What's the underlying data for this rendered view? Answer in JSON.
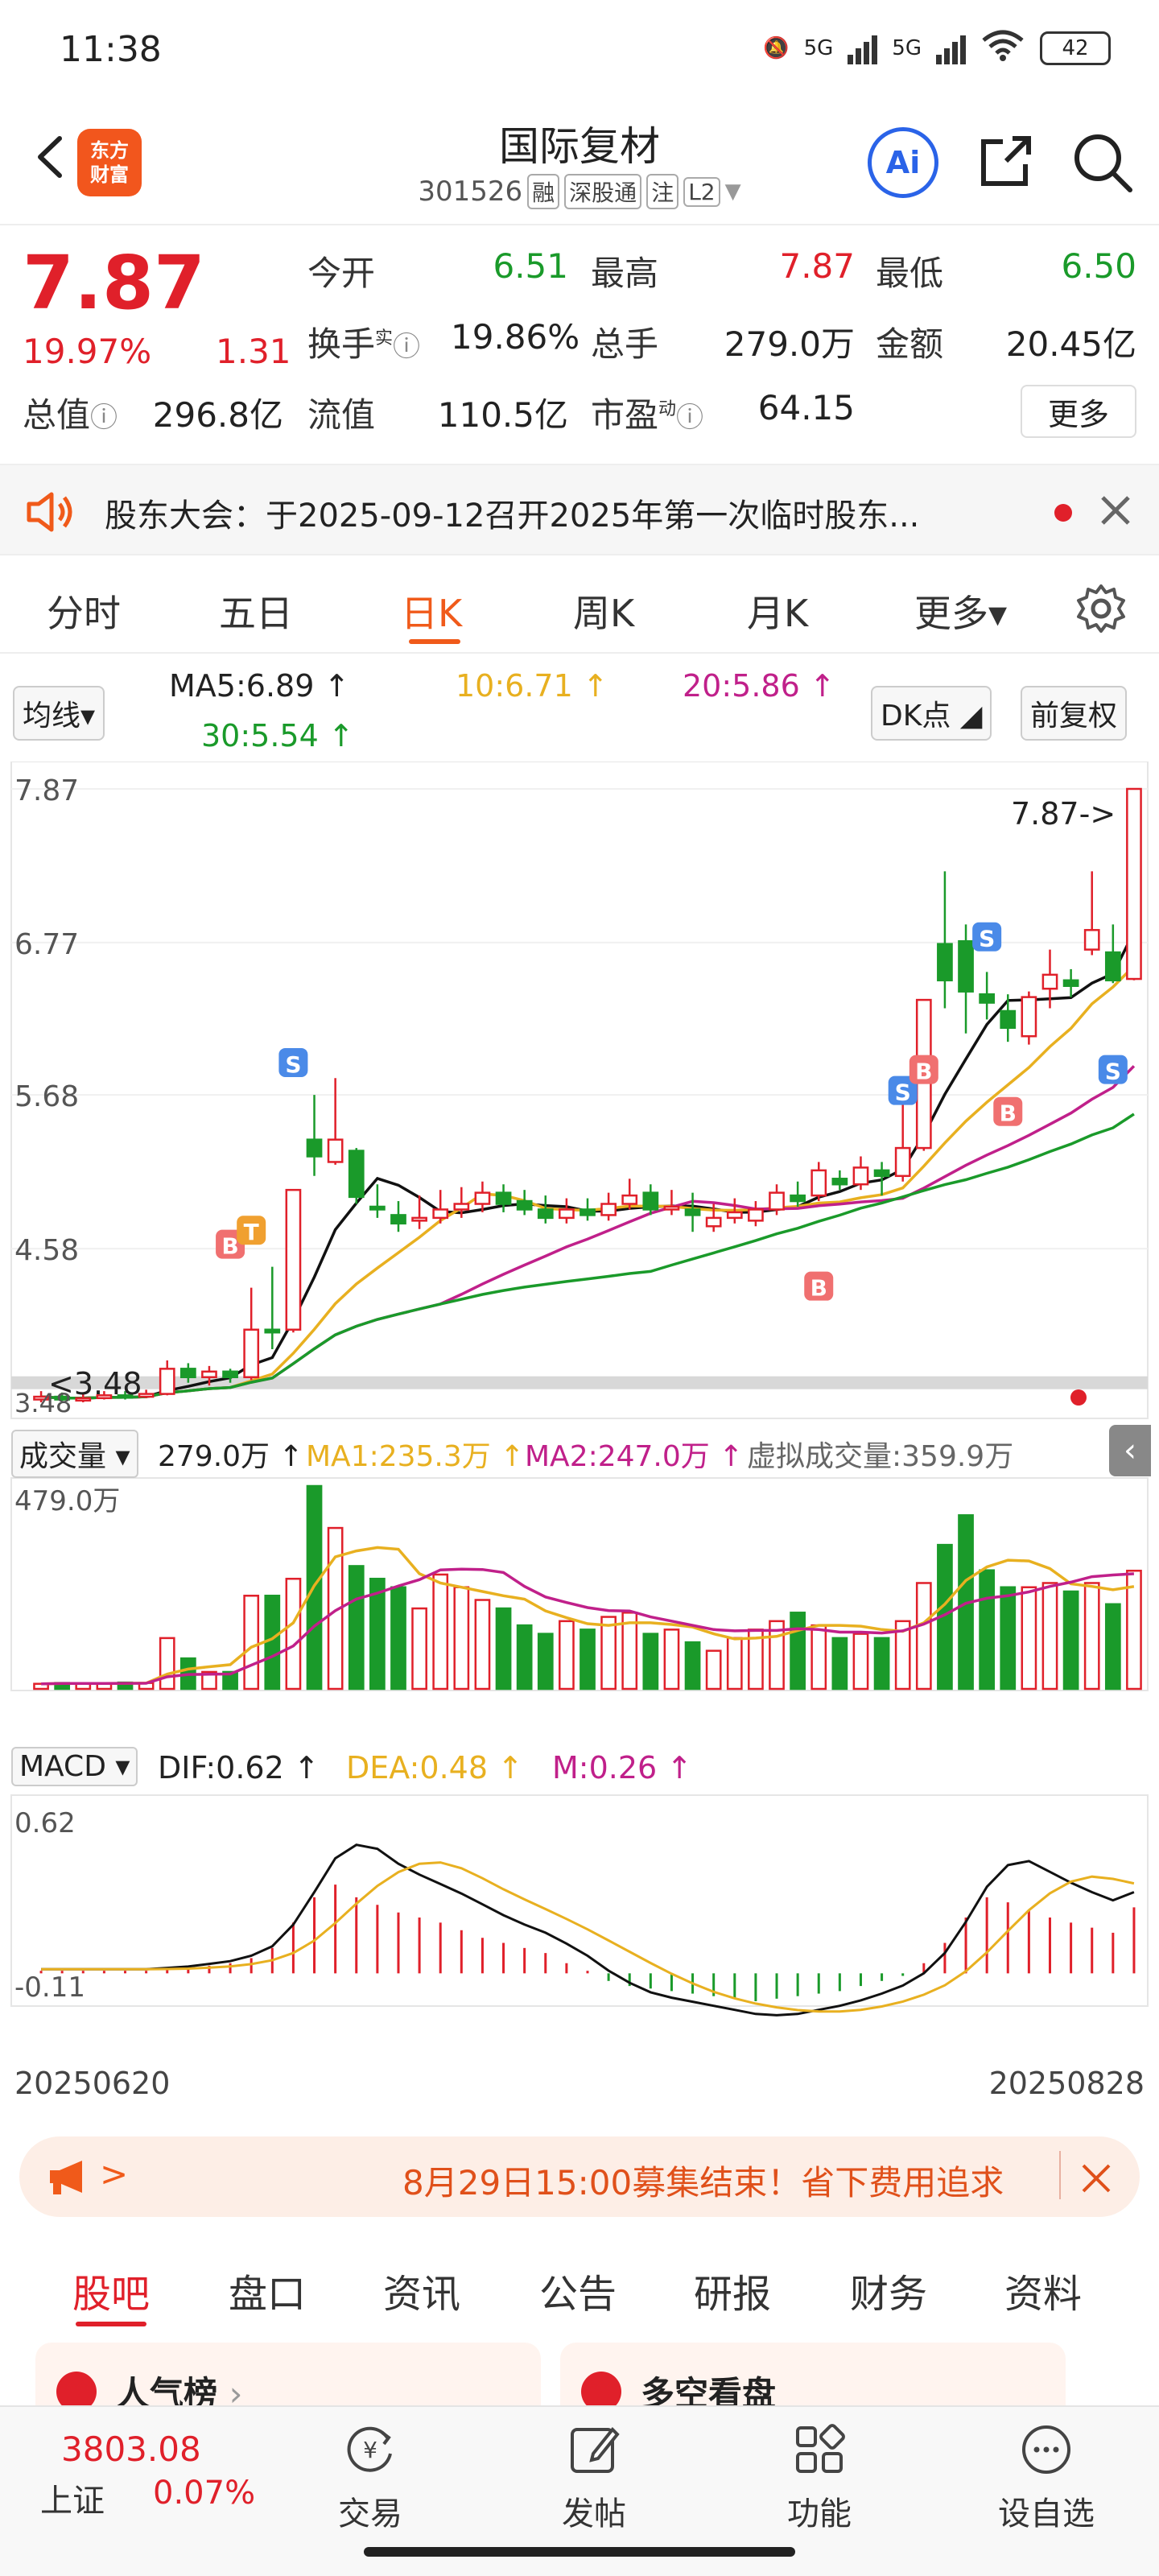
{
  "status_bar": {
    "time": "11:38",
    "network1": "5G",
    "network2": "5G",
    "wifi_label": "6",
    "battery": "42"
  },
  "header": {
    "app_logo": "东方\n财富",
    "app_logo_line1": "东方",
    "app_logo_line2": "财富",
    "stock_name": "国际复材",
    "stock_code": "301526",
    "tags": [
      "融",
      "深股通",
      "注",
      "L2"
    ],
    "ai_label": "Ai"
  },
  "quote": {
    "price": "7.87",
    "change_pct": "19.97%",
    "change_abs": "1.31",
    "today_open_label": "今开",
    "today_open": "6.51",
    "high_label": "最高",
    "high": "7.87",
    "low_label": "最低",
    "low": "6.50",
    "turnover_label": "换手",
    "turnover_sup": "实",
    "turnover": "19.86%",
    "volume_label": "总手",
    "volume": "279.0万",
    "amount_label": "金额",
    "amount": "20.45亿",
    "mktcap_label": "总值",
    "mktcap": "296.8亿",
    "float_label": "流值",
    "float_cap": "110.5亿",
    "pe_label": "市盈",
    "pe_sup": "动",
    "pe": "64.15",
    "more_label": "更多"
  },
  "notice": {
    "text": "股东大会：于2025-09-12召开2025年第一次临时股东..."
  },
  "period_tabs": [
    {
      "label": "分时"
    },
    {
      "label": "五日"
    },
    {
      "label": "日K"
    },
    {
      "label": "周K"
    },
    {
      "label": "月K"
    },
    {
      "label": "更多▾"
    }
  ],
  "indicators": {
    "ma_select": "均线▾",
    "ma5": "MA5:6.89",
    "ma10": "10:6.71",
    "ma20": "20:5.86",
    "ma30": "30:5.54",
    "dk_label": "DK点",
    "adjust_label": "前复权"
  },
  "kline": {
    "y_ticks": [
      "7.87",
      "6.77",
      "5.68",
      "4.58"
    ],
    "last_label": "7.87->",
    "low_label": "3.48",
    "low_axis": "3.48",
    "markers": [
      "B",
      "T",
      "S",
      "B",
      "S",
      "B",
      "S",
      "B",
      "S"
    ]
  },
  "volume": {
    "select": "成交量",
    "vol": "279.0万",
    "ma1": "MA1:235.3万",
    "ma2": "MA2:247.0万",
    "virtual": "虚拟成交量:359.9万",
    "axis_max": "479.0万"
  },
  "macd": {
    "select": "MACD",
    "dif": "DIF:0.62",
    "dea": "DEA:0.48",
    "m": "M:0.26",
    "axis_top": "0.62",
    "axis_bottom": "-0.11"
  },
  "dates": {
    "start": "20250620",
    "end": "20250828"
  },
  "banner": {
    "text": "8月29日15:00募集结束！省下费用追求"
  },
  "content_tabs": [
    "股吧",
    "盘口",
    "资讯",
    "公告",
    "研报",
    "财务",
    "资料"
  ],
  "cards": [
    {
      "title": "人气榜"
    },
    {
      "title": "多空看盘"
    }
  ],
  "bottom_nav": {
    "index_value": "3803.08",
    "index_name": "上证",
    "index_pct": "0.07%",
    "items": [
      {
        "label": "交易"
      },
      {
        "label": "发帖"
      },
      {
        "label": "功能"
      },
      {
        "label": "设自选"
      }
    ]
  },
  "colors": {
    "up": "#e0202a",
    "down": "#1a9a2a",
    "accent": "#f05a1a",
    "ai": "#2a63e8"
  },
  "chart_data": [
    {
      "type": "candlestick",
      "title": "日K",
      "x": [
        "20250620",
        "20250828"
      ],
      "y_ticks": [
        7.87,
        6.77,
        5.68,
        4.58
      ],
      "ylim": [
        3.48,
        7.87
      ],
      "candles": [
        {
          "o": 3.5,
          "c": 3.52,
          "h": 3.56,
          "l": 3.48
        },
        {
          "o": 3.52,
          "c": 3.5,
          "h": 3.55,
          "l": 3.49
        },
        {
          "o": 3.5,
          "c": 3.51,
          "h": 3.54,
          "l": 3.48
        },
        {
          "o": 3.51,
          "c": 3.53,
          "h": 3.56,
          "l": 3.5
        },
        {
          "o": 3.53,
          "c": 3.52,
          "h": 3.56,
          "l": 3.5
        },
        {
          "o": 3.52,
          "c": 3.54,
          "h": 3.57,
          "l": 3.51
        },
        {
          "o": 3.54,
          "c": 3.72,
          "h": 3.78,
          "l": 3.53
        },
        {
          "o": 3.72,
          "c": 3.66,
          "h": 3.76,
          "l": 3.62
        },
        {
          "o": 3.66,
          "c": 3.7,
          "h": 3.74,
          "l": 3.6
        },
        {
          "o": 3.7,
          "c": 3.66,
          "h": 3.72,
          "l": 3.62
        },
        {
          "o": 3.66,
          "c": 4.0,
          "h": 4.3,
          "l": 3.64
        },
        {
          "o": 4.0,
          "c": 3.98,
          "h": 4.45,
          "l": 3.86
        },
        {
          "o": 4.0,
          "c": 5.0,
          "h": 5.0,
          "l": 3.98
        },
        {
          "o": 5.36,
          "c": 5.24,
          "h": 5.68,
          "l": 5.1
        },
        {
          "o": 5.2,
          "c": 5.36,
          "h": 5.8,
          "l": 5.18
        },
        {
          "o": 5.28,
          "c": 4.95,
          "h": 5.3,
          "l": 4.9
        },
        {
          "o": 4.88,
          "c": 4.86,
          "h": 5.04,
          "l": 4.8
        },
        {
          "o": 4.82,
          "c": 4.76,
          "h": 4.92,
          "l": 4.7
        },
        {
          "o": 4.78,
          "c": 4.8,
          "h": 4.96,
          "l": 4.72
        },
        {
          "o": 4.8,
          "c": 4.86,
          "h": 5.0,
          "l": 4.76
        },
        {
          "o": 4.86,
          "c": 4.9,
          "h": 5.02,
          "l": 4.8
        },
        {
          "o": 4.9,
          "c": 4.98,
          "h": 5.06,
          "l": 4.84
        },
        {
          "o": 4.98,
          "c": 4.9,
          "h": 5.04,
          "l": 4.84
        },
        {
          "o": 4.92,
          "c": 4.86,
          "h": 5.0,
          "l": 4.82
        },
        {
          "o": 4.86,
          "c": 4.8,
          "h": 4.96,
          "l": 4.76
        },
        {
          "o": 4.8,
          "c": 4.86,
          "h": 4.94,
          "l": 4.76
        },
        {
          "o": 4.86,
          "c": 4.82,
          "h": 4.94,
          "l": 4.78
        },
        {
          "o": 4.82,
          "c": 4.9,
          "h": 4.98,
          "l": 4.78
        },
        {
          "o": 4.9,
          "c": 4.96,
          "h": 5.08,
          "l": 4.86
        },
        {
          "o": 4.98,
          "c": 4.86,
          "h": 5.04,
          "l": 4.82
        },
        {
          "o": 4.86,
          "c": 4.88,
          "h": 5.0,
          "l": 4.82
        },
        {
          "o": 4.86,
          "c": 4.82,
          "h": 4.98,
          "l": 4.7
        },
        {
          "o": 4.74,
          "c": 4.8,
          "h": 4.9,
          "l": 4.7
        },
        {
          "o": 4.8,
          "c": 4.84,
          "h": 4.94,
          "l": 4.76
        },
        {
          "o": 4.78,
          "c": 4.86,
          "h": 4.92,
          "l": 4.74
        },
        {
          "o": 4.86,
          "c": 4.98,
          "h": 5.04,
          "l": 4.82
        },
        {
          "o": 4.96,
          "c": 4.92,
          "h": 5.06,
          "l": 4.88
        },
        {
          "o": 4.96,
          "c": 5.14,
          "h": 5.2,
          "l": 4.92
        },
        {
          "o": 5.08,
          "c": 5.04,
          "h": 5.14,
          "l": 5.0
        },
        {
          "o": 5.04,
          "c": 5.16,
          "h": 5.24,
          "l": 5.0
        },
        {
          "o": 5.14,
          "c": 5.1,
          "h": 5.2,
          "l": 4.96
        },
        {
          "o": 5.1,
          "c": 5.3,
          "h": 5.8,
          "l": 5.06
        },
        {
          "o": 5.3,
          "c": 6.36,
          "h": 6.36,
          "l": 5.28
        },
        {
          "o": 6.76,
          "c": 6.5,
          "h": 7.28,
          "l": 6.3
        },
        {
          "o": 6.78,
          "c": 6.42,
          "h": 6.9,
          "l": 6.12
        },
        {
          "o": 6.4,
          "c": 6.34,
          "h": 6.56,
          "l": 6.22
        },
        {
          "o": 6.28,
          "c": 6.16,
          "h": 6.4,
          "l": 6.06
        },
        {
          "o": 6.1,
          "c": 6.38,
          "h": 6.42,
          "l": 6.04
        },
        {
          "o": 6.44,
          "c": 6.54,
          "h": 6.72,
          "l": 6.3
        },
        {
          "o": 6.5,
          "c": 6.46,
          "h": 6.58,
          "l": 6.38
        },
        {
          "o": 6.72,
          "c": 6.86,
          "h": 7.28,
          "l": 6.68
        },
        {
          "o": 6.7,
          "c": 6.5,
          "h": 6.9,
          "l": 6.48
        },
        {
          "o": 6.51,
          "c": 7.87,
          "h": 7.87,
          "l": 6.5
        }
      ]
    },
    {
      "type": "bar",
      "title": "成交量",
      "ylim": [
        0,
        479.0
      ],
      "unit": "万",
      "values": [
        12,
        14,
        12,
        13,
        15,
        14,
        120,
        72,
        40,
        40,
        220,
        220,
        260,
        479,
        380,
        290,
        260,
        240,
        190,
        270,
        240,
        210,
        190,
        150,
        130,
        160,
        140,
        170,
        180,
        130,
        140,
        110,
        90,
        120,
        140,
        160,
        180,
        150,
        120,
        130,
        120,
        160,
        250,
        340,
        410,
        280,
        240,
        240,
        250,
        230,
        250,
        200,
        279
      ]
    },
    {
      "type": "bar",
      "title": "MACD",
      "ylim": [
        -0.11,
        0.62
      ],
      "values": [
        0.01,
        0.01,
        0.01,
        0.01,
        0.01,
        0.01,
        0.02,
        0.02,
        0.03,
        0.04,
        0.06,
        0.1,
        0.2,
        0.3,
        0.35,
        0.3,
        0.27,
        0.24,
        0.22,
        0.2,
        0.17,
        0.14,
        0.12,
        0.1,
        0.08,
        0.04,
        0.01,
        -0.03,
        -0.05,
        -0.06,
        -0.07,
        -0.08,
        -0.09,
        -0.1,
        -0.11,
        -0.1,
        -0.09,
        -0.08,
        -0.07,
        -0.05,
        -0.03,
        -0.01,
        0.04,
        0.12,
        0.22,
        0.3,
        0.28,
        0.25,
        0.22,
        0.2,
        0.18,
        0.16,
        0.26
      ]
    }
  ]
}
